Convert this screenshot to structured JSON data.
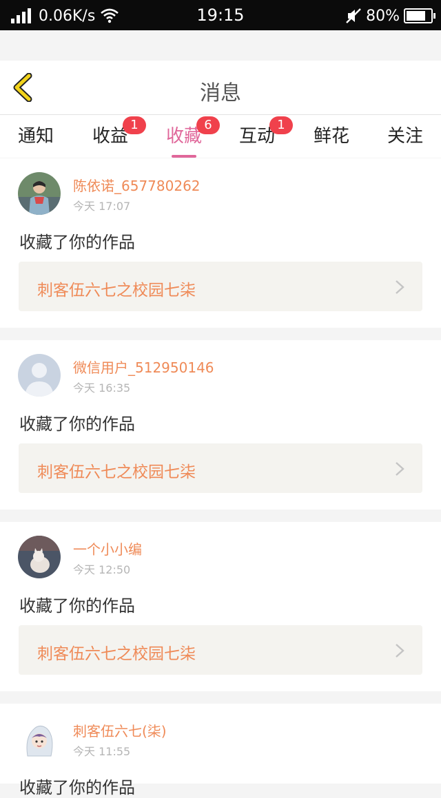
{
  "status_bar": {
    "net_speed": "0.06K/s",
    "time": "19:15",
    "battery": "80%",
    "battery_level": 0.8
  },
  "header": {
    "title": "消息",
    "back_icon": "chevron-left-icon"
  },
  "tabs": [
    {
      "label": "通知",
      "badge": "",
      "active": false
    },
    {
      "label": "收益",
      "badge": "1",
      "active": false
    },
    {
      "label": "收藏",
      "badge": "6",
      "active": true
    },
    {
      "label": "互动",
      "badge": "1",
      "active": false
    },
    {
      "label": "鲜花",
      "badge": "",
      "active": false
    },
    {
      "label": "关注",
      "badge": "",
      "active": false
    }
  ],
  "messages": [
    {
      "user": "陈依诺_657780262",
      "time": "今天 17:07",
      "action": "收藏了你的作品",
      "work": "刺客伍六七之校园七柒"
    },
    {
      "user": "微信用户_512950146",
      "time": "今天 16:35",
      "action": "收藏了你的作品",
      "work": "刺客伍六七之校园七柒"
    },
    {
      "user": "一个小小编",
      "time": "今天 12:50",
      "action": "收藏了你的作品",
      "work": "刺客伍六七之校园七柒"
    },
    {
      "user": "刺客伍六七(柒)",
      "time": "今天 11:55",
      "action": "收藏了你的作品",
      "work": ""
    }
  ],
  "colors": {
    "accent_pink": "#e0679a",
    "badge_red": "#f0414c",
    "name_orange": "#ef8a57",
    "back_yellow": "#f2d31b"
  }
}
